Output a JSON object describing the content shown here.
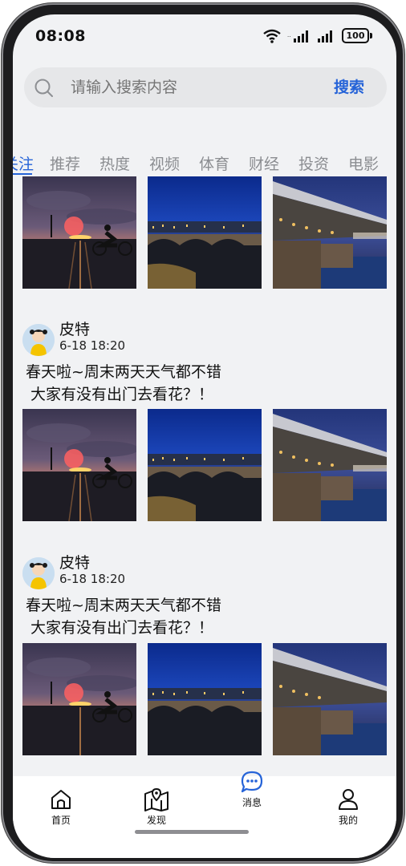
{
  "status_bar": {
    "time": "08:08",
    "battery": "100",
    "icons": [
      "wifi-icon",
      "signal-icon",
      "signal-icon",
      "battery-icon"
    ]
  },
  "search": {
    "placeholder": "请输入搜索内容",
    "button_label": "搜索"
  },
  "tabs": [
    {
      "label": "关注",
      "active": true
    },
    {
      "label": "推荐",
      "active": false
    },
    {
      "label": "热度",
      "active": false
    },
    {
      "label": "视频",
      "active": false
    },
    {
      "label": "体育",
      "active": false
    },
    {
      "label": "财经",
      "active": false
    },
    {
      "label": "投资",
      "active": false
    },
    {
      "label": "电影",
      "active": false
    }
  ],
  "posts": [
    {
      "author": "皮特",
      "time": "6-18 18:20",
      "text": "春天啦~周末两天天气都不错\n 大家有没有出门去看花？！"
    },
    {
      "author": "皮特",
      "time": "6-18 18:20",
      "text": "春天啦~周末两天天气都不错\n 大家有没有出门去看花？！"
    }
  ],
  "photos": [
    "sunset-cyclist-photo",
    "bridge-night-photo",
    "bridge-river-photo"
  ],
  "bottom_nav": [
    {
      "label": "首页",
      "icon": "home-icon",
      "active": false
    },
    {
      "label": "发现",
      "icon": "map-icon",
      "active": false
    },
    {
      "label": "消息",
      "icon": "message-icon",
      "active": true
    },
    {
      "label": "我的",
      "icon": "user-icon",
      "active": false
    }
  ],
  "colors": {
    "accent": "#2563d8",
    "background": "#f1f2f4",
    "inactive_tab": "#8b8d91"
  }
}
